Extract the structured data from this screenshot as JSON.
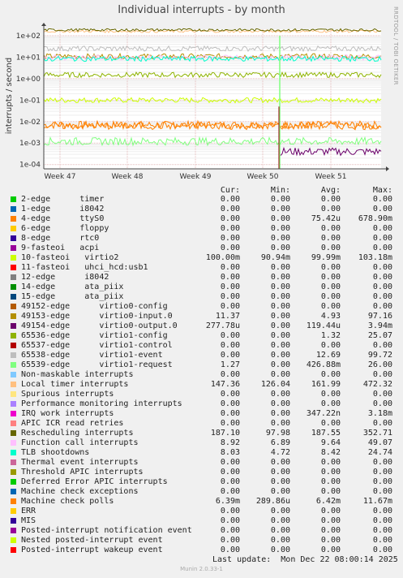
{
  "title": "Individual interrupts - by month",
  "side_label": "RRDTOOL / TOBI OETIKER",
  "footer": {
    "last_update": "Last update:  Mon Dec 22 08:00:14 2025",
    "version": "Munin 2.0.33-1"
  },
  "legend_headers": {
    "cur": "Cur:",
    "min": "Min:",
    "avg": "Avg:",
    "max": "Max:"
  },
  "chart_data": {
    "type": "line",
    "ylabel": "interrupts / second",
    "yscale": "log",
    "y_ticks": [
      "1e+02",
      "1e+01",
      "1e+00",
      "1e-01",
      "1e-02",
      "1e-03",
      "1e-04"
    ],
    "x_ticks": [
      "Week 47",
      "Week 48",
      "Week 49",
      "Week 50",
      "Week 51"
    ],
    "grid": true,
    "series": [
      {
        "name": "2-edge      timer",
        "color": "#00cc00",
        "cur": "0.00",
        "min": "0.00",
        "avg": "0.00",
        "max": "0.00"
      },
      {
        "name": "1-edge      i8042",
        "color": "#0066b3",
        "cur": "0.00",
        "min": "0.00",
        "avg": "0.00",
        "max": "0.00"
      },
      {
        "name": "4-edge      ttyS0",
        "color": "#ff8000",
        "cur": "0.00",
        "min": "0.00",
        "avg": "75.42u",
        "max": "678.90m",
        "level": 0.007
      },
      {
        "name": "6-edge      floppy",
        "color": "#ffcc00",
        "cur": "0.00",
        "min": "0.00",
        "avg": "0.00",
        "max": "0.00"
      },
      {
        "name": "8-edge      rtc0",
        "color": "#330099",
        "cur": "0.00",
        "min": "0.00",
        "avg": "0.00",
        "max": "0.00"
      },
      {
        "name": "9-fasteoi   acpi",
        "color": "#990099",
        "cur": "0.00",
        "min": "0.00",
        "avg": "0.00",
        "max": "0.00"
      },
      {
        "name": "10-fasteoi   virtio2",
        "color": "#ccff00",
        "cur": "100.00m",
        "min": "90.94m",
        "avg": "99.99m",
        "max": "103.18m",
        "level": 0.1
      },
      {
        "name": "11-fasteoi   uhci_hcd:usb1",
        "color": "#ff0000",
        "cur": "0.00",
        "min": "0.00",
        "avg": "0.00",
        "max": "0.00"
      },
      {
        "name": "12-edge      i8042",
        "color": "#808080",
        "cur": "0.00",
        "min": "0.00",
        "avg": "0.00",
        "max": "0.00"
      },
      {
        "name": "14-edge      ata_piix",
        "color": "#008f00",
        "cur": "0.00",
        "min": "0.00",
        "avg": "0.00",
        "max": "0.00"
      },
      {
        "name": "15-edge      ata_piix",
        "color": "#00487d",
        "cur": "0.00",
        "min": "0.00",
        "avg": "0.00",
        "max": "0.00"
      },
      {
        "name": "49152-edge      virtio0-config",
        "color": "#b35a00",
        "cur": "0.00",
        "min": "0.00",
        "avg": "0.00",
        "max": "0.00"
      },
      {
        "name": "49153-edge      virtio0-input.0",
        "color": "#b38f00",
        "cur": "11.37",
        "min": "0.00",
        "avg": "4.93",
        "max": "97.16",
        "level": 11
      },
      {
        "name": "49154-edge      virtio0-output.0",
        "color": "#6b006b",
        "cur": "277.78u",
        "min": "0.00",
        "avg": "119.44u",
        "max": "3.94m",
        "level": 0.0004
      },
      {
        "name": "65536-edge      virtio1-config",
        "color": "#8fb300",
        "cur": "0.00",
        "min": "0.00",
        "avg": "1.32",
        "max": "25.07",
        "level": 1.5
      },
      {
        "name": "65537-edge      virtio1-control",
        "color": "#b30000",
        "cur": "0.00",
        "min": "0.00",
        "avg": "0.00",
        "max": "0.00"
      },
      {
        "name": "65538-edge      virtio1-event",
        "color": "#bebebe",
        "cur": "0.00",
        "min": "0.00",
        "avg": "12.69",
        "max": "99.72",
        "level": 25
      },
      {
        "name": "65539-edge      virtio1-request",
        "color": "#80ff80",
        "cur": "1.27",
        "min": "0.00",
        "avg": "426.88m",
        "max": "26.00",
        "level": 0.0012
      },
      {
        "name": "Non-maskable interrupts",
        "color": "#80c9ff",
        "cur": "0.00",
        "min": "0.00",
        "avg": "0.00",
        "max": "0.00"
      },
      {
        "name": "Local timer interrupts",
        "color": "#ffc080",
        "cur": "147.36",
        "min": "126.04",
        "avg": "161.99",
        "max": "472.32",
        "level": 160
      },
      {
        "name": "Spurious interrupts",
        "color": "#ffe680",
        "cur": "0.00",
        "min": "0.00",
        "avg": "0.00",
        "max": "0.00"
      },
      {
        "name": "Performance monitoring interrupts",
        "color": "#aa80ff",
        "cur": "0.00",
        "min": "0.00",
        "avg": "0.00",
        "max": "0.00"
      },
      {
        "name": "IRQ work interrupts",
        "color": "#ee00cc",
        "cur": "0.00",
        "min": "0.00",
        "avg": "347.22n",
        "max": "3.18m"
      },
      {
        "name": "APIC ICR read retries",
        "color": "#ff8080",
        "cur": "0.00",
        "min": "0.00",
        "avg": "0.00",
        "max": "0.00"
      },
      {
        "name": "Rescheduling interrupts",
        "color": "#666600",
        "cur": "187.10",
        "min": "97.98",
        "avg": "187.55",
        "max": "352.71",
        "level": 185
      },
      {
        "name": "Function call interrupts",
        "color": "#ffbfff",
        "cur": "8.92",
        "min": "6.89",
        "avg": "9.64",
        "max": "49.07",
        "level": 9.6
      },
      {
        "name": "TLB shootdowns",
        "color": "#00ffcc",
        "cur": "8.03",
        "min": "4.72",
        "avg": "8.42",
        "max": "24.74",
        "level": 8.4
      },
      {
        "name": "Thermal event interrupts",
        "color": "#cc6699",
        "cur": "0.00",
        "min": "0.00",
        "avg": "0.00",
        "max": "0.00"
      },
      {
        "name": "Threshold APIC interrupts",
        "color": "#999900",
        "cur": "0.00",
        "min": "0.00",
        "avg": "0.00",
        "max": "0.00"
      },
      {
        "name": "Deferred Error APIC interrupts",
        "color": "#00cc00",
        "cur": "0.00",
        "min": "0.00",
        "avg": "0.00",
        "max": "0.00"
      },
      {
        "name": "Machine check exceptions",
        "color": "#0066b3",
        "cur": "0.00",
        "min": "0.00",
        "avg": "0.00",
        "max": "0.00"
      },
      {
        "name": "Machine check polls",
        "color": "#ff8000",
        "cur": "6.39m",
        "min": "289.86u",
        "avg": "6.42m",
        "max": "11.67m",
        "level": 0.0064
      },
      {
        "name": "ERR",
        "color": "#ffcc00",
        "cur": "0.00",
        "min": "0.00",
        "avg": "0.00",
        "max": "0.00"
      },
      {
        "name": "MIS",
        "color": "#330099",
        "cur": "0.00",
        "min": "0.00",
        "avg": "0.00",
        "max": "0.00"
      },
      {
        "name": "Posted-interrupt notification event",
        "color": "#990099",
        "cur": "0.00",
        "min": "0.00",
        "avg": "0.00",
        "max": "0.00"
      },
      {
        "name": "Nested posted-interrupt event",
        "color": "#ccff00",
        "cur": "0.00",
        "min": "0.00",
        "avg": "0.00",
        "max": "0.00"
      },
      {
        "name": "Posted-interrupt wakeup event",
        "color": "#ff0000",
        "cur": "0.00",
        "min": "0.00",
        "avg": "0.00",
        "max": "0.00"
      }
    ]
  }
}
